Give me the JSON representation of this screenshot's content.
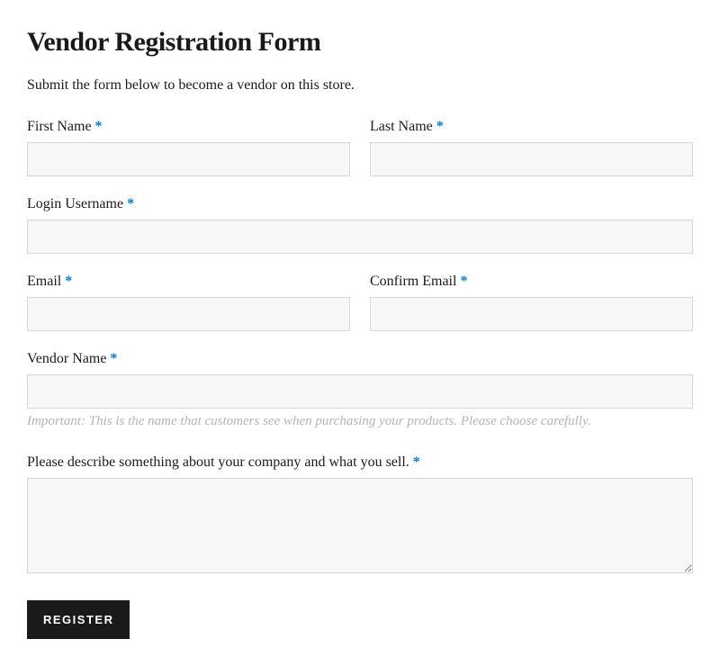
{
  "header": {
    "title": "Vendor Registration Form",
    "subtitle": "Submit the form below to become a vendor on this store."
  },
  "form": {
    "required_symbol": "*",
    "first_name": {
      "label": "First Name ",
      "value": ""
    },
    "last_name": {
      "label": "Last Name ",
      "value": ""
    },
    "login_username": {
      "label": "Login Username ",
      "value": ""
    },
    "email": {
      "label": "Email ",
      "value": ""
    },
    "confirm_email": {
      "label": "Confirm Email ",
      "value": ""
    },
    "vendor_name": {
      "label": "Vendor Name ",
      "value": "",
      "hint": "Important: This is the name that customers see when purchasing your products. Please choose carefully."
    },
    "description": {
      "label": "Please describe something about your company and what you sell. ",
      "value": ""
    },
    "submit_label": "REGISTER"
  }
}
